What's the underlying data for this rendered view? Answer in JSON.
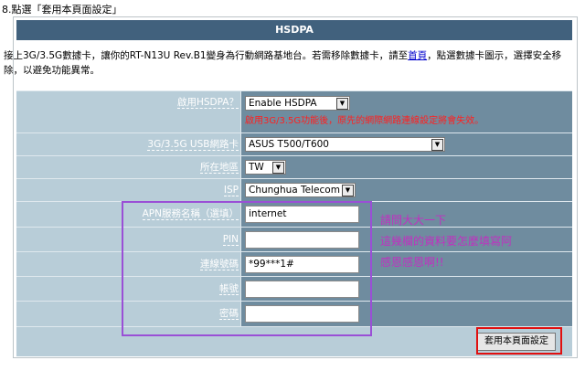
{
  "step_text": "8.點選「套用本頁面設定」",
  "header_title": "HSDPA",
  "description": {
    "before_link": "接上3G/3.5G數據卡，讓你的RT-N13U Rev.B1變身為行動網路基地台。若需移除數據卡，請至",
    "link": "首頁",
    "after_link": "，點選數據卡圖示，選擇安全移除，以避免功能異常。"
  },
  "fields": {
    "enable": {
      "label": "啟用HSDPA？",
      "value": "Enable HSDPA",
      "warning": "啟用3G/3.5G功能後，原先的網際網路連線設定將會失效。"
    },
    "adapter": {
      "label": "3G/3.5G USB網路卡",
      "value": "ASUS T500/T600"
    },
    "location": {
      "label": "所在地區",
      "value": "TW"
    },
    "isp": {
      "label": "ISP",
      "value": "Chunghua Telecom"
    },
    "apn": {
      "label": "APN服務名稱（選填）",
      "value": "internet"
    },
    "pin": {
      "label": "PIN",
      "value": ""
    },
    "dial": {
      "label": "連線號碼",
      "value": "*99***1#"
    },
    "username": {
      "label": "帳號",
      "value": ""
    },
    "password": {
      "label": "密碼",
      "value": ""
    }
  },
  "annotation": {
    "line1": "請問大大一下",
    "line2": "這幾欄的資料要怎麼填寫阿",
    "line3": "感恩感恩啊!!"
  },
  "apply_label": "套用本頁面設定",
  "colors": {
    "header": "#41617d",
    "form_bg": "#b8cdd8",
    "cell_bg": "#6f8c9f",
    "warning": "#ff2020",
    "annotation": "#c030c0",
    "highlight_box": "#9a4fd6",
    "red_box": "#e01010"
  }
}
